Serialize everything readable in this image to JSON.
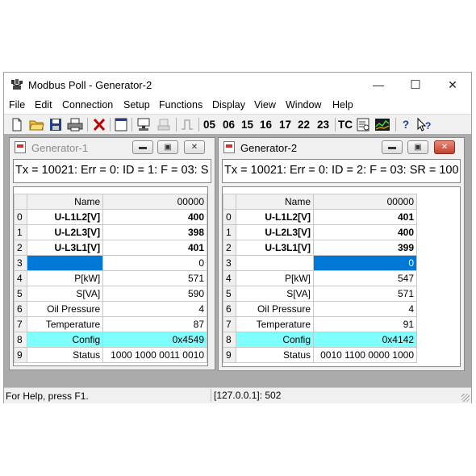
{
  "app": {
    "title": "Modbus Poll - Generator-2"
  },
  "window_controls": {
    "minimize": "—",
    "maximize": "☐",
    "close": "✕"
  },
  "menu": [
    "File",
    "Edit",
    "Connection",
    "Setup",
    "Functions",
    "Display",
    "View",
    "Window",
    "Help"
  ],
  "toolbar": {
    "function_codes": [
      "05",
      "06",
      "15",
      "16",
      "17",
      "22",
      "23"
    ],
    "tc_label": "TC",
    "help_label": "?",
    "context_help_label": "❓"
  },
  "child_windows": [
    {
      "title": "Generator-1",
      "status_line": "Tx = 10021: Err = 0: ID = 1: F = 03: S",
      "header": {
        "name": "Name",
        "value": "00000"
      },
      "rows": [
        {
          "index": "0",
          "name": "U-L1L2[V]",
          "value": "400"
        },
        {
          "index": "1",
          "name": "U-L2L3[V]",
          "value": "398"
        },
        {
          "index": "2",
          "name": "U-L3L1[V]",
          "value": "401"
        },
        {
          "index": "3",
          "name": "",
          "value": "0"
        },
        {
          "index": "4",
          "name": "P[kW]",
          "value": "571"
        },
        {
          "index": "5",
          "name": "S[VA]",
          "value": "590"
        },
        {
          "index": "6",
          "name": "Oil Pressure",
          "value": "4"
        },
        {
          "index": "7",
          "name": "Temperature",
          "value": "87"
        },
        {
          "index": "8",
          "name": "Config",
          "value": "0x4549"
        },
        {
          "index": "9",
          "name": "Status",
          "value": "1000 1000 0011 0010"
        }
      ]
    },
    {
      "title": "Generator-2",
      "status_line": "Tx = 10021: Err = 0: ID = 2: F = 03: SR = 100",
      "header": {
        "name": "Name",
        "value": "00000"
      },
      "rows": [
        {
          "index": "0",
          "name": "U-L1L2[V]",
          "value": "401"
        },
        {
          "index": "1",
          "name": "U-L2L3[V]",
          "value": "400"
        },
        {
          "index": "2",
          "name": "U-L3L1[V]",
          "value": "399"
        },
        {
          "index": "3",
          "name": "",
          "value": "0"
        },
        {
          "index": "4",
          "name": "P[kW]",
          "value": "547"
        },
        {
          "index": "5",
          "name": "S[VA]",
          "value": "571"
        },
        {
          "index": "6",
          "name": "Oil Pressure",
          "value": "4"
        },
        {
          "index": "7",
          "name": "Temperature",
          "value": "91"
        },
        {
          "index": "8",
          "name": "Config",
          "value": "0x4142"
        },
        {
          "index": "9",
          "name": "Status",
          "value": "0010 1100 0000 1000"
        }
      ]
    }
  ],
  "statusbar": {
    "help": "For Help, press F1.",
    "connection": "[127.0.0.1]: 502"
  },
  "colors": {
    "highlight_cyan": "#80ffff",
    "selection_blue": "#0078d7",
    "mdi_background": "#ababab"
  }
}
